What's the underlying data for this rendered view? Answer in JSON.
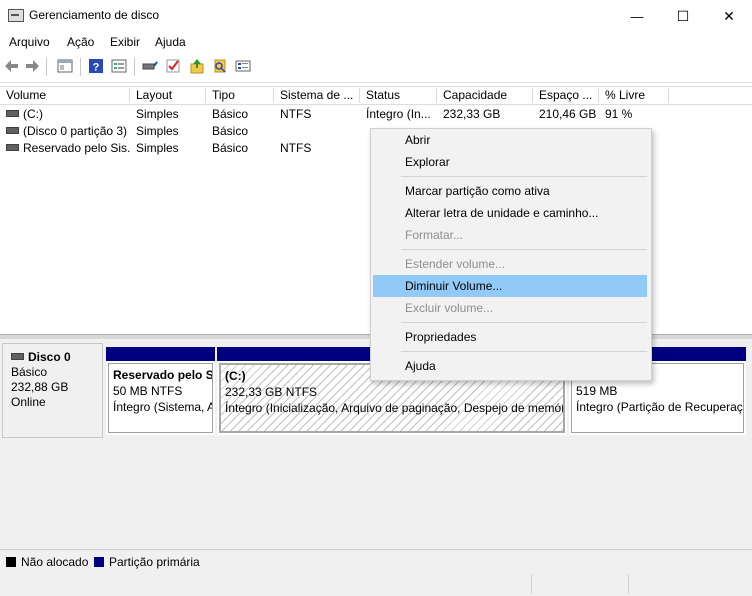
{
  "window": {
    "title": "Gerenciamento de disco",
    "min_glyph": "—",
    "max_glyph": "☐",
    "close_glyph": "✕"
  },
  "menu": [
    "Arquivo",
    "Ação",
    "Exibir",
    "Ajuda"
  ],
  "toolbar_icons": [
    "back-icon",
    "forward-icon",
    "console-tree-icon",
    "help-icon",
    "properties-icon",
    "connect-drive-icon",
    "check-icon",
    "import-icon",
    "search-icon",
    "settings-list-icon"
  ],
  "volume_table": {
    "columns": [
      "Volume",
      "Layout",
      "Tipo",
      "Sistema de ...",
      "Status",
      "Capacidade",
      "Espaço ...",
      "% Livre"
    ],
    "rows": [
      [
        "(C:)",
        "Simples",
        "Básico",
        "NTFS",
        "Íntegro (In...",
        "232,33 GB",
        "210,46 GB",
        "91 %"
      ],
      [
        "(Disco 0 partição 3)",
        "Simples",
        "Básico",
        "",
        "",
        "",
        "",
        ""
      ],
      [
        "Reservado pelo Sis...",
        "Simples",
        "Básico",
        "NTFS",
        "",
        "",
        "",
        ""
      ]
    ]
  },
  "context_menu": {
    "items": [
      {
        "label": "Abrir",
        "disabled": false
      },
      {
        "label": "Explorar",
        "disabled": false
      },
      {
        "label": "Marcar partição como ativa",
        "disabled": false
      },
      {
        "label": "Alterar letra de unidade e caminho...",
        "disabled": false
      },
      {
        "label": "Formatar...",
        "disabled": true
      },
      {
        "label": "Estender volume...",
        "disabled": true
      },
      {
        "label": "Diminuir Volume...",
        "disabled": false,
        "highlighted": true
      },
      {
        "label": "Excluir volume...",
        "disabled": true
      },
      {
        "label": "Propriedades",
        "disabled": false
      },
      {
        "label": "Ajuda",
        "disabled": false
      }
    ]
  },
  "disk": {
    "name": "Disco 0",
    "type": "Básico",
    "size": "232,88 GB",
    "state": "Online"
  },
  "partitions": [
    {
      "name": "Reservado pelo S",
      "size": "50 MB NTFS",
      "status": "Íntegro (Sistema, A"
    },
    {
      "name": "(C:)",
      "size": "232,33 GB NTFS",
      "status": "Íntegro (Inicialização, Arquivo de paginação, Despejo de memór"
    },
    {
      "name": "",
      "size": "519 MB",
      "status": "Íntegro (Partição de Recuperaç"
    }
  ],
  "legend": {
    "unallocated": "Não alocado",
    "primary": "Partição primária",
    "unallocated_color": "#000000",
    "primary_color": "#010080"
  },
  "colors": {
    "partition_bar": "#010080",
    "menu_highlight": "#91c9f7"
  }
}
